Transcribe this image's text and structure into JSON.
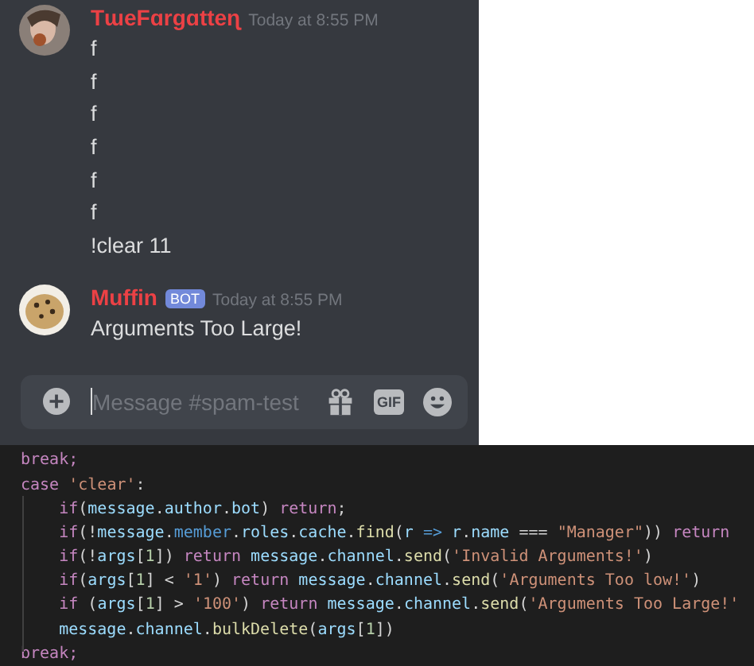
{
  "chat": {
    "messages": [
      {
        "author": "TɯeFɑrgɑtteɳ",
        "avatar": {
          "kind": "picture"
        },
        "timestamp": "Today at 8:55 PM",
        "lines": [
          "f",
          "f",
          "f",
          "f",
          "f",
          "f",
          "!clear 11"
        ]
      },
      {
        "author": "Muffin",
        "avatar": {
          "kind": "picture"
        },
        "badge": "BOT",
        "timestamp": "Today at 8:55 PM",
        "lines": [
          "Arguments Too Large!"
        ]
      }
    ],
    "composer": {
      "placeholder": "Message #spam-test",
      "buttons": [
        {
          "kind": "gift"
        },
        {
          "kind": "gif",
          "label": "GIF"
        },
        {
          "kind": "emoji"
        }
      ]
    }
  },
  "code": {
    "lines": [
      [
        {
          "t": "break;",
          "color": "#c586c0"
        }
      ],
      [
        {
          "t": "case ",
          "color": "#c586c0"
        },
        {
          "t": "'clear'",
          "color": "#ce9178"
        },
        {
          "t": ":",
          "color": "#d4d4d4"
        }
      ],
      [
        {
          "t": "    if",
          "color": "#c586c0"
        },
        {
          "t": "(",
          "color": "#d4d4d4"
        },
        {
          "t": "message",
          "color": "#9cdcfe"
        },
        {
          "t": ".",
          "color": "#d4d4d4"
        },
        {
          "t": "author",
          "color": "#9cdcfe"
        },
        {
          "t": ".",
          "color": "#d4d4d4"
        },
        {
          "t": "bot",
          "color": "#9cdcfe"
        },
        {
          "t": ") ",
          "color": "#d4d4d4"
        },
        {
          "t": "return",
          "color": "#c586c0"
        },
        {
          "t": ";",
          "color": "#d4d4d4"
        }
      ],
      [
        {
          "t": "    if",
          "color": "#c586c0"
        },
        {
          "t": "(!",
          "color": "#d4d4d4"
        },
        {
          "t": "message",
          "color": "#9cdcfe"
        },
        {
          "t": ".",
          "color": "#d4d4d4"
        },
        {
          "t": "member",
          "color": "#569cd6"
        },
        {
          "t": ".",
          "color": "#d4d4d4"
        },
        {
          "t": "roles",
          "color": "#9cdcfe"
        },
        {
          "t": ".",
          "color": "#d4d4d4"
        },
        {
          "t": "cache",
          "color": "#9cdcfe"
        },
        {
          "t": ".",
          "color": "#d4d4d4"
        },
        {
          "t": "find",
          "color": "#dcdcaa"
        },
        {
          "t": "(",
          "color": "#d4d4d4"
        },
        {
          "t": "r",
          "color": "#9cdcfe"
        },
        {
          "t": " => ",
          "color": "#569cd6"
        },
        {
          "t": "r",
          "color": "#9cdcfe"
        },
        {
          "t": ".",
          "color": "#d4d4d4"
        },
        {
          "t": "name",
          "color": "#9cdcfe"
        },
        {
          "t": " === ",
          "color": "#d4d4d4"
        },
        {
          "t": "\"Manager\"",
          "color": "#ce9178"
        },
        {
          "t": ")) ",
          "color": "#d4d4d4"
        },
        {
          "t": "return",
          "color": "#c586c0"
        }
      ],
      [
        {
          "t": "    if",
          "color": "#c586c0"
        },
        {
          "t": "(!",
          "color": "#d4d4d4"
        },
        {
          "t": "args",
          "color": "#9cdcfe"
        },
        {
          "t": "[",
          "color": "#d4d4d4"
        },
        {
          "t": "1",
          "color": "#b5cea8"
        },
        {
          "t": "]) ",
          "color": "#d4d4d4"
        },
        {
          "t": "return ",
          "color": "#c586c0"
        },
        {
          "t": "message",
          "color": "#9cdcfe"
        },
        {
          "t": ".",
          "color": "#d4d4d4"
        },
        {
          "t": "channel",
          "color": "#9cdcfe"
        },
        {
          "t": ".",
          "color": "#d4d4d4"
        },
        {
          "t": "send",
          "color": "#dcdcaa"
        },
        {
          "t": "(",
          "color": "#d4d4d4"
        },
        {
          "t": "'Invalid Arguments!'",
          "color": "#ce9178"
        },
        {
          "t": ")",
          "color": "#d4d4d4"
        }
      ],
      [
        {
          "t": "    if",
          "color": "#c586c0"
        },
        {
          "t": "(",
          "color": "#d4d4d4"
        },
        {
          "t": "args",
          "color": "#9cdcfe"
        },
        {
          "t": "[",
          "color": "#d4d4d4"
        },
        {
          "t": "1",
          "color": "#b5cea8"
        },
        {
          "t": "] < ",
          "color": "#d4d4d4"
        },
        {
          "t": "'1'",
          "color": "#ce9178"
        },
        {
          "t": ") ",
          "color": "#d4d4d4"
        },
        {
          "t": "return ",
          "color": "#c586c0"
        },
        {
          "t": "message",
          "color": "#9cdcfe"
        },
        {
          "t": ".",
          "color": "#d4d4d4"
        },
        {
          "t": "channel",
          "color": "#9cdcfe"
        },
        {
          "t": ".",
          "color": "#d4d4d4"
        },
        {
          "t": "send",
          "color": "#dcdcaa"
        },
        {
          "t": "(",
          "color": "#d4d4d4"
        },
        {
          "t": "'Arguments Too low!'",
          "color": "#ce9178"
        },
        {
          "t": ")",
          "color": "#d4d4d4"
        }
      ],
      [
        {
          "t": "    if ",
          "color": "#c586c0"
        },
        {
          "t": "(",
          "color": "#d4d4d4"
        },
        {
          "t": "args",
          "color": "#9cdcfe"
        },
        {
          "t": "[",
          "color": "#d4d4d4"
        },
        {
          "t": "1",
          "color": "#b5cea8"
        },
        {
          "t": "] > ",
          "color": "#d4d4d4"
        },
        {
          "t": "'100'",
          "color": "#ce9178"
        },
        {
          "t": ") ",
          "color": "#d4d4d4"
        },
        {
          "t": "return ",
          "color": "#c586c0"
        },
        {
          "t": "message",
          "color": "#9cdcfe"
        },
        {
          "t": ".",
          "color": "#d4d4d4"
        },
        {
          "t": "channel",
          "color": "#9cdcfe"
        },
        {
          "t": ".",
          "color": "#d4d4d4"
        },
        {
          "t": "send",
          "color": "#dcdcaa"
        },
        {
          "t": "(",
          "color": "#d4d4d4"
        },
        {
          "t": "'Arguments Too Large!'",
          "color": "#ce9178"
        }
      ],
      [
        {
          "t": "    message",
          "color": "#9cdcfe"
        },
        {
          "t": ".",
          "color": "#d4d4d4"
        },
        {
          "t": "channel",
          "color": "#9cdcfe"
        },
        {
          "t": ".",
          "color": "#d4d4d4"
        },
        {
          "t": "bulkDelete",
          "color": "#dcdcaa"
        },
        {
          "t": "(",
          "color": "#d4d4d4"
        },
        {
          "t": "args",
          "color": "#9cdcfe"
        },
        {
          "t": "[",
          "color": "#d4d4d4"
        },
        {
          "t": "1",
          "color": "#b5cea8"
        },
        {
          "t": "])",
          "color": "#d4d4d4"
        }
      ],
      [
        {
          "t": "break;",
          "color": "#c586c0"
        }
      ]
    ]
  }
}
